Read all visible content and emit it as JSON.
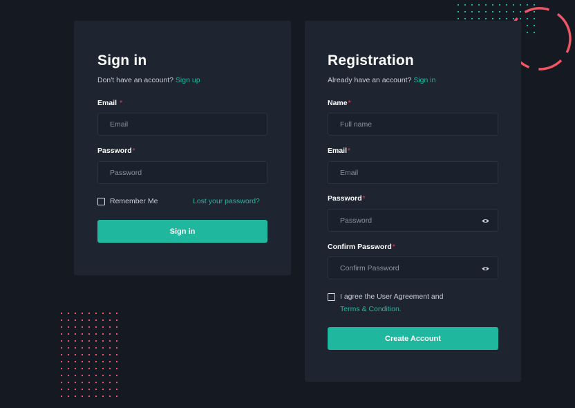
{
  "signin": {
    "title": "Sign in",
    "subtitle_text": "Don't have an account?",
    "subtitle_link": "Sign up",
    "email_label": "Email",
    "email_placeholder": "Email",
    "password_label": "Password",
    "password_placeholder": "Password",
    "remember_label": "Remember Me",
    "forgot_link": "Lost your password?",
    "submit_label": "Sign in"
  },
  "register": {
    "title": "Registration",
    "subtitle_text": "Already have an account?",
    "subtitle_link": "Sign in",
    "name_label": "Name",
    "name_placeholder": "Full name",
    "email_label": "Email",
    "email_placeholder": "Email",
    "password_label": "Password",
    "password_placeholder": "Password",
    "confirm_label": "Confirm Password",
    "confirm_placeholder": "Confirm Password",
    "agree_text": "I agree the User Agreement and",
    "terms_link": "Terms & Condition.",
    "submit_label": "Create Account"
  },
  "required_mark": "*",
  "colors": {
    "background": "#141922",
    "card": "#1e2430",
    "accent": "#1fb89f",
    "required": "#e2434f",
    "decor_red": "#f05564"
  },
  "icons": {
    "password_visibility": "eye-icon",
    "confirm_visibility": "eye-icon"
  }
}
